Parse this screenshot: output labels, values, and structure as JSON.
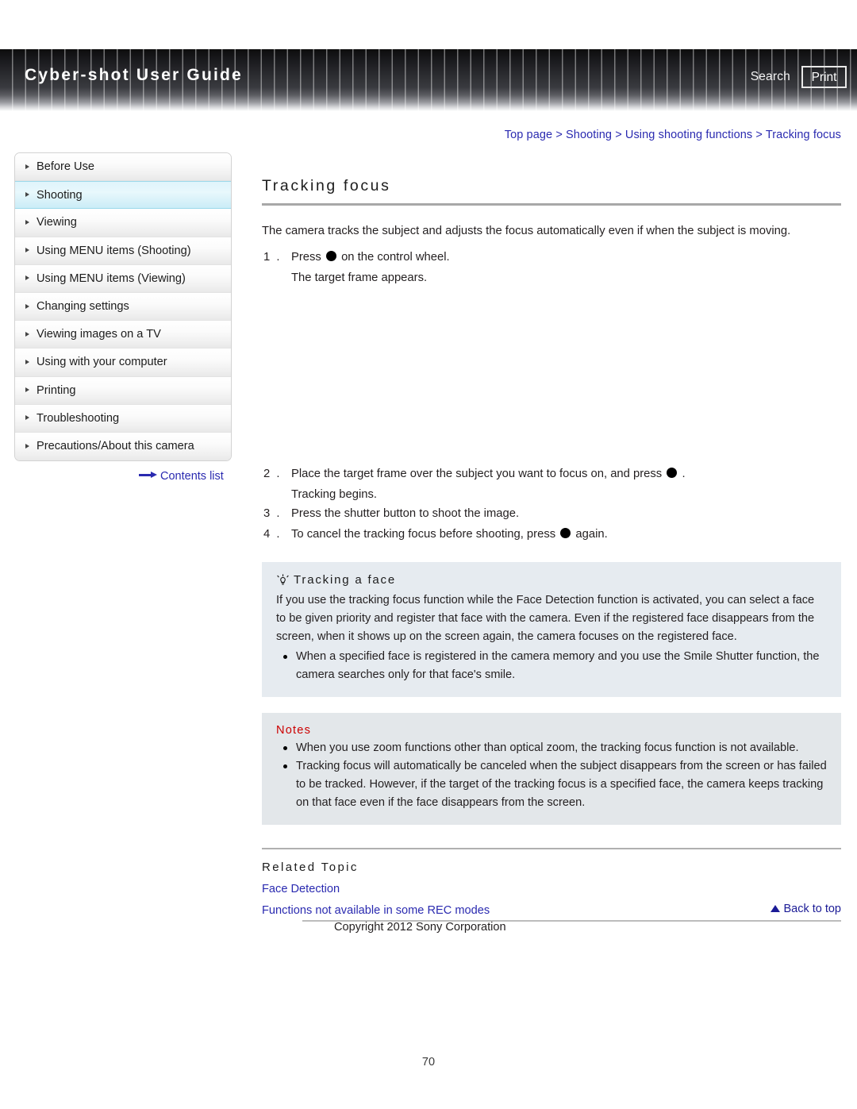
{
  "header": {
    "title": "Cyber-shot User Guide",
    "search_label": "Search",
    "print_label": "Print"
  },
  "breadcrumb": {
    "text": "Top page > Shooting > Using shooting functions > Tracking focus"
  },
  "sidebar": {
    "items": [
      {
        "label": "Before Use",
        "active": false
      },
      {
        "label": "Shooting",
        "active": true
      },
      {
        "label": "Viewing",
        "active": false
      },
      {
        "label": "Using MENU items (Shooting)",
        "active": false
      },
      {
        "label": "Using MENU items (Viewing)",
        "active": false
      },
      {
        "label": "Changing settings",
        "active": false
      },
      {
        "label": "Viewing images on a TV",
        "active": false
      },
      {
        "label": "Using with your computer",
        "active": false
      },
      {
        "label": "Printing",
        "active": false
      },
      {
        "label": "Troubleshooting",
        "active": false
      },
      {
        "label": "Precautions/About this camera",
        "active": false
      }
    ],
    "contents_list_label": "Contents list"
  },
  "main": {
    "title": "Tracking focus",
    "intro": "The camera tracks the subject and adjusts the focus automatically even if when the subject is moving.",
    "steps": [
      {
        "num": "1 .",
        "text_before": "Press",
        "has_dot": true,
        "text_after": "on the control wheel.",
        "sub": "The target frame appears."
      },
      {
        "num": "2 .",
        "text_before": "Place the target frame over the subject you want to focus on, and press",
        "has_dot": true,
        "text_after": ".",
        "sub": "Tracking begins."
      },
      {
        "num": "3 .",
        "text_before": "Press the shutter button to shoot the image.",
        "has_dot": false,
        "text_after": "",
        "sub": ""
      },
      {
        "num": "4 .",
        "text_before": "To cancel the tracking focus before shooting, press",
        "has_dot": true,
        "text_after": "again.",
        "sub": ""
      }
    ],
    "tip": {
      "icon": "lightbulb-icon",
      "heading": "Tracking a face",
      "body": "If you use the tracking focus function while the Face Detection function is activated, you can select a face to be given priority and register that face with the camera. Even if the registered face disappears from the screen, when it shows up on the screen again, the camera focuses on the registered face.",
      "bullets": [
        "When a specified face is registered in the camera memory and you use the Smile Shutter function, the camera searches only for that face's smile."
      ]
    },
    "notes": {
      "heading": "Notes",
      "items": [
        "When you use zoom functions other than optical zoom, the tracking focus function is not available.",
        "Tracking focus will automatically be canceled when the subject disappears from the screen or has failed to be tracked. However, if the target of the tracking focus is a specified face, the camera keeps tracking on that face even if the face disappears from the screen."
      ]
    },
    "related": {
      "heading": "Related Topic",
      "links": [
        "Face Detection",
        "Functions not available in some REC modes"
      ]
    }
  },
  "footer": {
    "back_to_top": "Back to top",
    "copyright": "Copyright 2012 Sony Corporation",
    "page_number": "70"
  },
  "colors": {
    "link": "#2a2ab0",
    "notes_heading": "#cc0000",
    "tip_background": "#e6ebf0",
    "notes_background": "#e3e7ea",
    "active_sidebar": "#d2eff8"
  }
}
